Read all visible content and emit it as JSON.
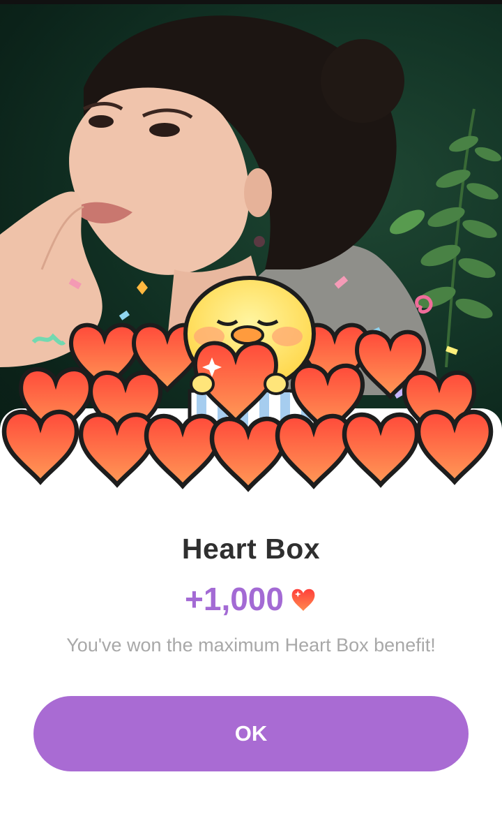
{
  "dialog": {
    "title": "Heart Box",
    "reward_amount": "+1,000",
    "reward_icon": "heart-icon",
    "message": "You've won the maximum Heart Box benefit!",
    "ok_label": "OK"
  },
  "illustration": {
    "banner": "woman-portrait",
    "character": "yellow-chick-holding-heart",
    "decoration": "pile-of-hearts-and-confetti"
  },
  "colors": {
    "accent": "#a96bd3",
    "reward_text": "#a36ad4",
    "title": "#2f2f2f",
    "message": "#a8a8a8",
    "heart": "#ff5a3c"
  }
}
